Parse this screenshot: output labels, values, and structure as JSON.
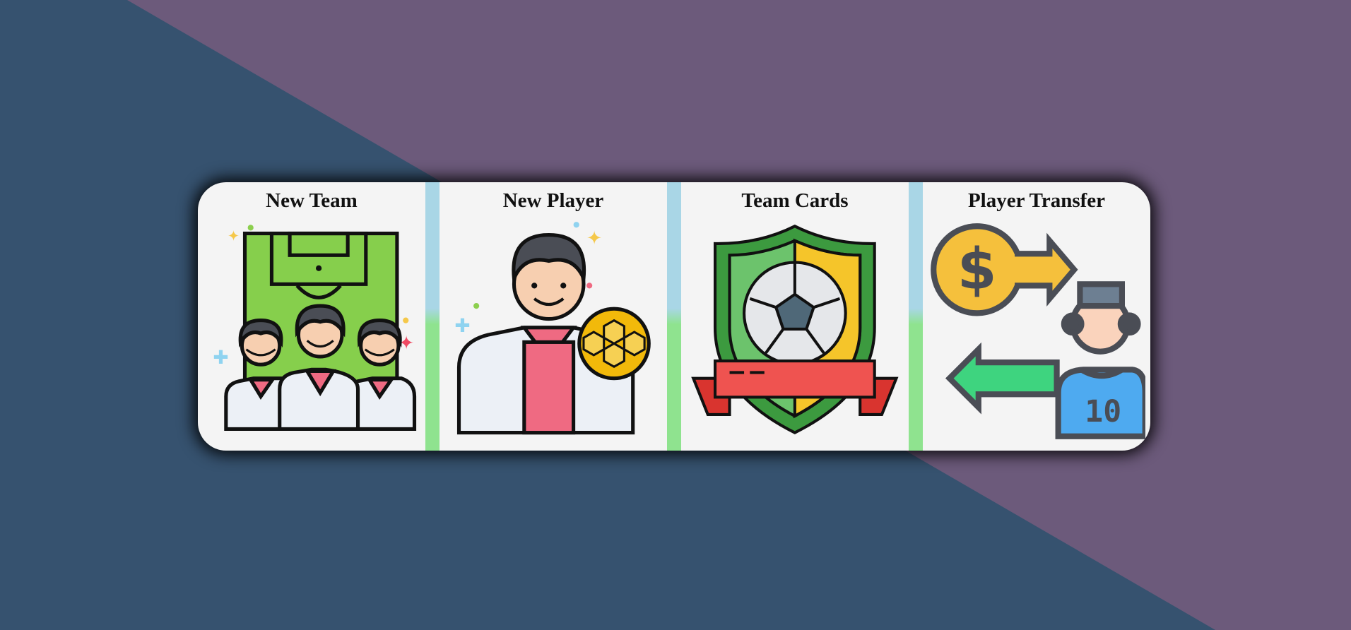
{
  "menu": {
    "cards": [
      {
        "title": "New Team",
        "icon": "team-icon"
      },
      {
        "title": "New Player",
        "icon": "player-icon"
      },
      {
        "title": "Team Cards",
        "icon": "badge-icon"
      },
      {
        "title": "Player Transfer",
        "icon": "transfer-icon"
      }
    ]
  },
  "player_card": {
    "jersey_number": "10"
  },
  "colors": {
    "background_blue": "#36526f",
    "background_purple": "#6c5a7b",
    "panel": "#f4f4f4",
    "divider_top": "#a9d6e6",
    "divider_bottom": "#8fe38f"
  }
}
